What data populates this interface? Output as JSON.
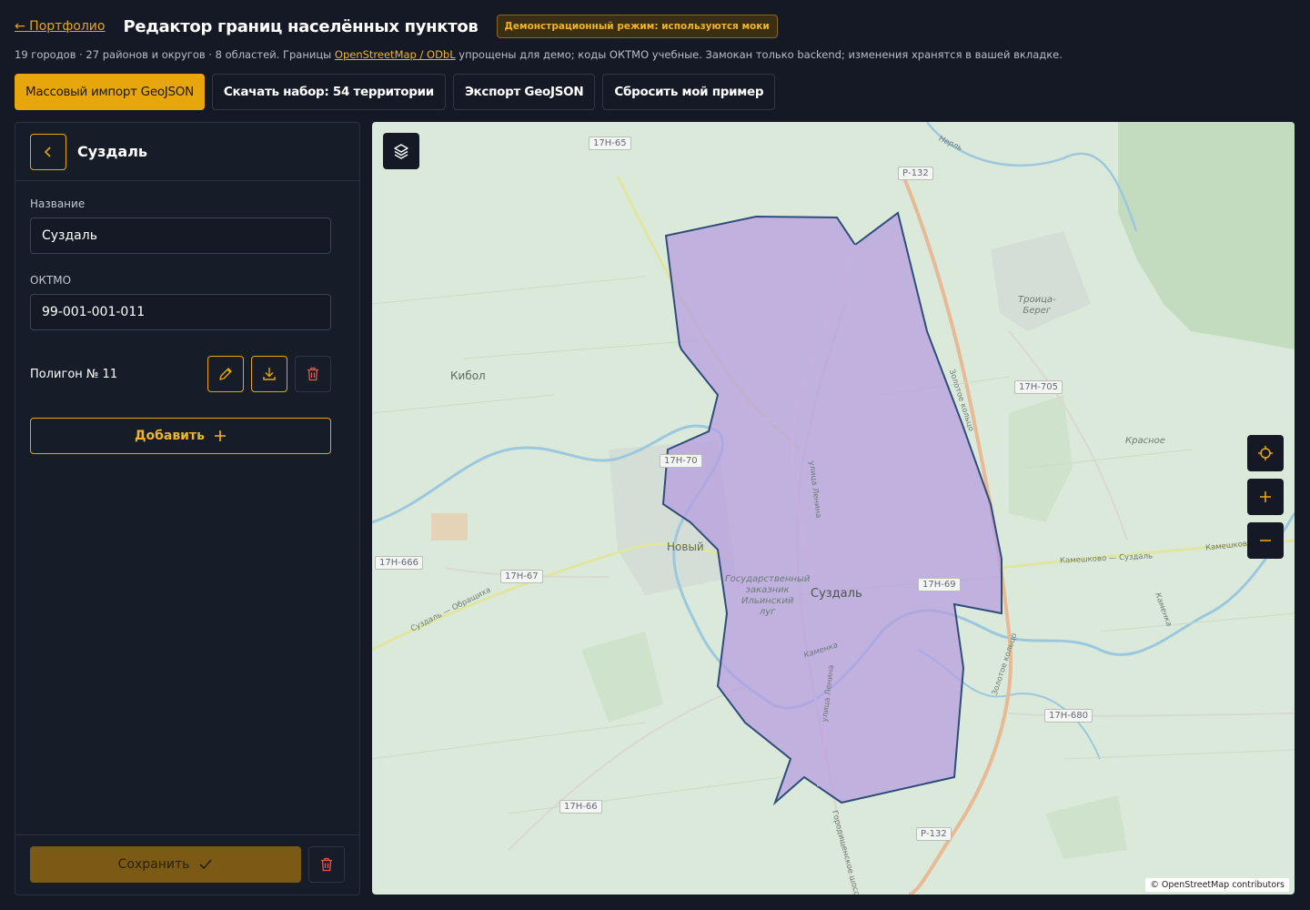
{
  "header": {
    "back_link": "← Портфолио",
    "title": "Редактор границ населённых пунктов",
    "demo_badge": "Демонстрационный режим: используются моки"
  },
  "subtitle": {
    "before": "19 городов · 27 районов и округов · 8 областей. Границы ",
    "link": "OpenStreetMap / ODbL",
    "after": " упрощены для демо; коды ОКТМО учебные. Замокан только backend; изменения хранятся в вашей вкладке."
  },
  "toolbar": {
    "import": "Массовый импорт GeoJSON",
    "download": "Скачать набор: 54 территории",
    "export": "Экспорт GeoJSON",
    "reset": "Сбросить мой пример"
  },
  "panel": {
    "title": "Суздаль",
    "name_label": "Название",
    "name_value": "Суздаль",
    "oktmo_label": "ОКТМО",
    "oktmo_value": "99-001-001-011",
    "polygon_label": "Полигон № 11",
    "add_label": "Добавить",
    "save_label": "Сохранить"
  },
  "map": {
    "attribution": "© OpenStreetMap contributors",
    "polygon_color": "#b79ee0",
    "labels": {
      "kibol": "Кибол",
      "novyi": "Новый",
      "suzdal": "Суздаль",
      "troitsa": "Троица-\nБерег",
      "krasnoe": "Красное",
      "zakaznik": "Государственный\nзаказник\nИльинский\nлуг",
      "kameshkovo_road": "Камешково — Суздаль",
      "obrashchikha_road": "Суздаль — Обращиха",
      "lenina_1": "улица Ленина",
      "lenina_2": "улица Ленина",
      "zolotoe_kolco_1": "Золотое кольцо",
      "zolotoe_kolco_2": "Золотое кольцо",
      "gorodishchenskoe": "Городищенское шоссе",
      "nerl": "Нерль",
      "kamenka_1": "Каменка",
      "kamenka_2": "Каменка",
      "kameshkovo": "Камешково"
    },
    "shields": [
      "17Н-65",
      "Р-132",
      "17Н-705",
      "17Н-70",
      "17Н-666",
      "17Н-67",
      "17Н-69",
      "17Н-680",
      "17Н-66",
      "Р-132"
    ]
  },
  "icons": {
    "back": "chevron-left-icon",
    "edit": "pencil-icon",
    "download": "download-icon",
    "delete": "trash-icon",
    "add": "plus-icon",
    "save": "check-icon",
    "layers": "layers-icon",
    "locate": "crosshair-icon",
    "zoom_in": "plus-icon",
    "zoom_out": "minus-icon"
  },
  "colors": {
    "accent": "#e6a60c",
    "background": "#141925",
    "danger": "#e05a4f"
  }
}
